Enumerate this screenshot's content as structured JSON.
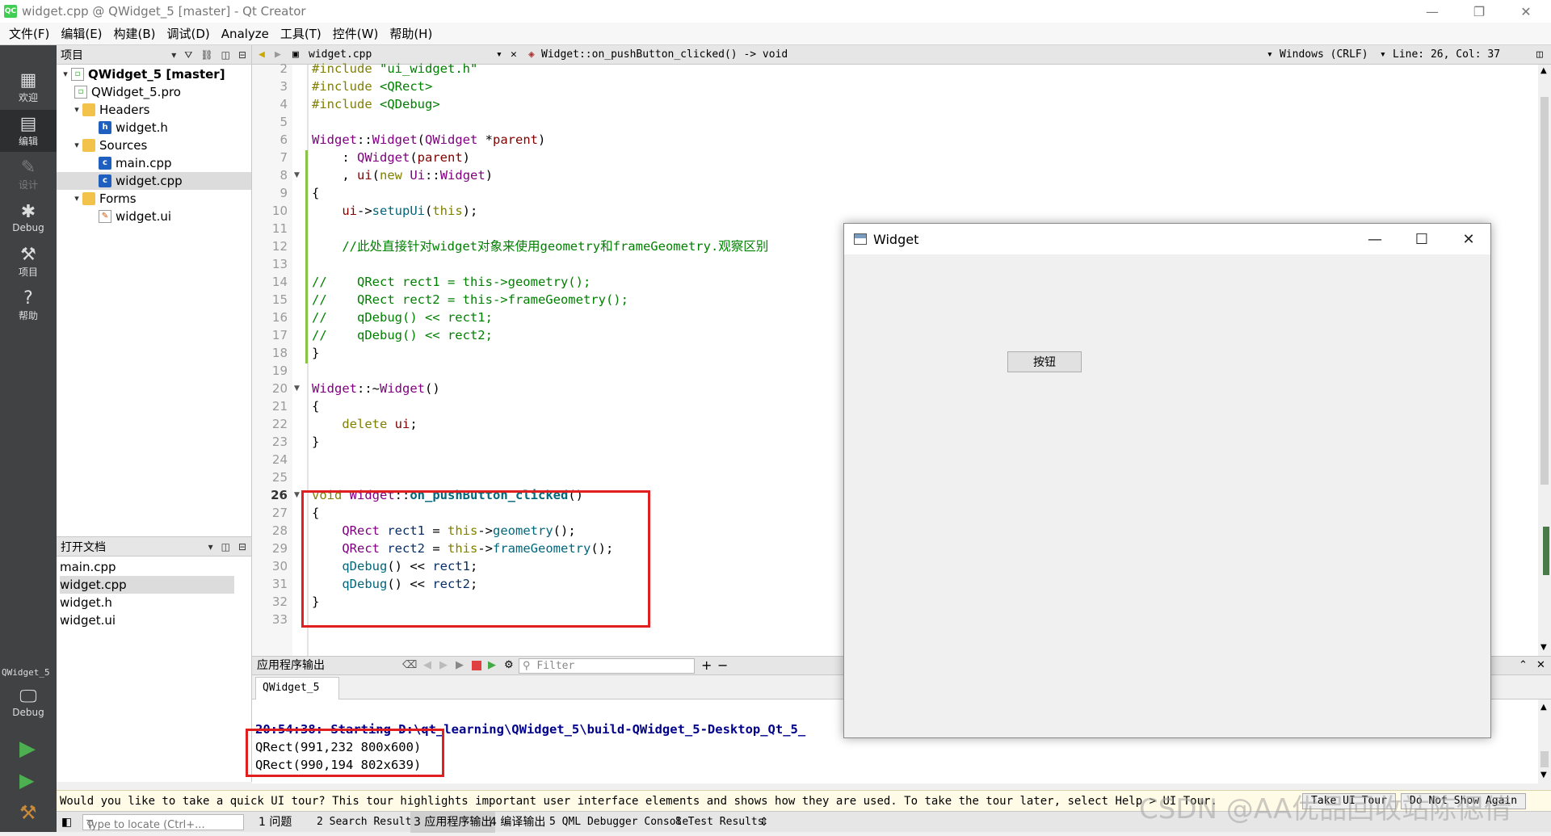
{
  "window": {
    "title": "widget.cpp @ QWidget_5 [master] - Qt Creator",
    "app_icon": "QC"
  },
  "menu": [
    "文件(F)",
    "编辑(E)",
    "构建(B)",
    "调试(D)",
    "Analyze",
    "工具(T)",
    "控件(W)",
    "帮助(H)"
  ],
  "modes": [
    {
      "label": "欢迎",
      "icon": "grid-icon"
    },
    {
      "label": "编辑",
      "icon": "edit-icon"
    },
    {
      "label": "设计",
      "icon": "pencil-icon"
    },
    {
      "label": "Debug",
      "icon": "bug-icon"
    },
    {
      "label": "项目",
      "icon": "wrench-icon"
    },
    {
      "label": "帮助",
      "icon": "help-icon"
    }
  ],
  "kit": {
    "project": "QWidget_5",
    "mode": "Debug"
  },
  "project_panel": {
    "title": "项目",
    "tree": [
      {
        "label": "QWidget_5 [master]",
        "bold": true
      },
      {
        "label": "QWidget_5.pro"
      },
      {
        "label": "Headers"
      },
      {
        "label": "widget.h"
      },
      {
        "label": "Sources"
      },
      {
        "label": "main.cpp"
      },
      {
        "label": "widget.cpp"
      },
      {
        "label": "Forms"
      },
      {
        "label": "widget.ui"
      }
    ]
  },
  "open_docs": {
    "title": "打开文档",
    "items": [
      "main.cpp",
      "widget.cpp",
      "widget.h",
      "widget.ui"
    ]
  },
  "editor_toolbar": {
    "file": "widget.cpp",
    "symbol": "Widget::on_pushButton_clicked() -> void",
    "line_ending": "Windows (CRLF)",
    "position": "Line: 26, Col: 37"
  },
  "code": {
    "line_numbers": [
      "2",
      "3",
      "4",
      "5",
      "6",
      "7",
      "8",
      "9",
      "10",
      "11",
      "12",
      "13",
      "14",
      "15",
      "16",
      "17",
      "18",
      "19",
      "20",
      "21",
      "22",
      "23",
      "24",
      "25",
      "26",
      "27",
      "28",
      "29",
      "30",
      "31",
      "32",
      "33"
    ],
    "lines": [
      "#include \"ui_widget.h\"",
      "#include <QRect>",
      "#include <QDebug>",
      "",
      "Widget::Widget(QWidget *parent)",
      "    : QWidget(parent)",
      "    , ui(new Ui::Widget)",
      "{",
      "    ui->setupUi(this);",
      "",
      "    //此处直接针对widget对象来使用geometry和frameGeometry.观察区别",
      "",
      "//    QRect rect1 = this->geometry();",
      "//    QRect rect2 = this->frameGeometry();",
      "//    qDebug() << rect1;",
      "//    qDebug() << rect2;",
      "}",
      "",
      "Widget::~Widget()",
      "{",
      "    delete ui;",
      "}",
      "",
      "",
      "void Widget::on_pushButton_clicked()",
      "{",
      "    QRect rect1 = this->geometry();",
      "    QRect rect2 = this->frameGeometry();",
      "    qDebug() << rect1;",
      "    qDebug() << rect2;",
      "}",
      ""
    ]
  },
  "output": {
    "title": "应用程序输出",
    "filter_placeholder": "Filter",
    "tab": "QWidget_5",
    "lines": [
      "20:54:38: Starting D:\\qt_learning\\QWidget_5\\build-QWidget_5-Desktop_Qt_5_",
      "QRect(991,232 800x600)",
      "QRect(990,194 802x639)"
    ]
  },
  "infobar": {
    "message": "Would you like to take a quick UI tour? This tour highlights important user interface elements and shows how they are used. To take the tour later, select Help > UI Tour.",
    "take_tour": "Take UI Tour",
    "dont_show": "Do Not Show Again"
  },
  "statusbar": {
    "locator_placeholder": "Type to locate (Ctrl+...",
    "tabs": [
      "1 问题",
      "2 Search Results",
      "3 应用程序输出",
      "4 编译输出",
      "5 QML Debugger Console",
      "8 Test Results"
    ]
  },
  "widget_window": {
    "title": "Widget",
    "button": "按钮"
  },
  "watermark": "CSDN @AA优品回收站陈偲倩",
  "colors": {
    "modebar": "#404244",
    "highlight_box": "#e02020",
    "infobar": "#fffbe6"
  }
}
